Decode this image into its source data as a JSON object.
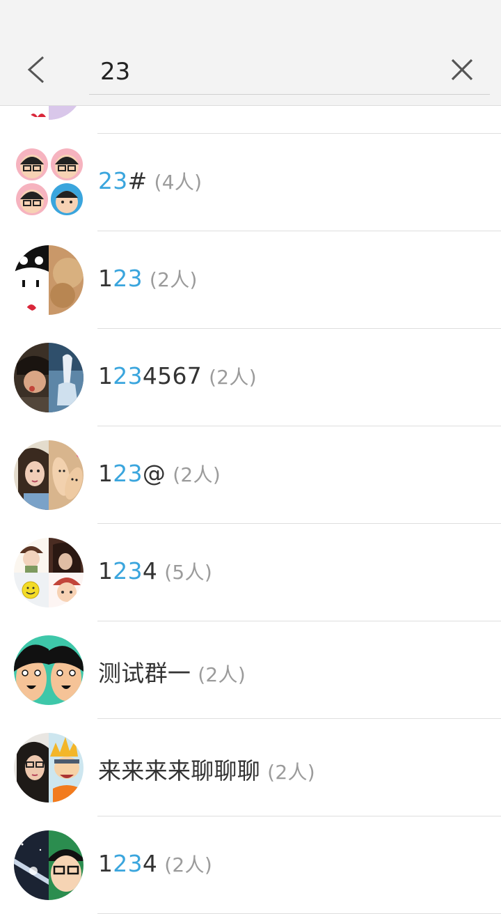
{
  "search": {
    "value": "23"
  },
  "groups": [
    {
      "pre": "",
      "hl": "",
      "post": "",
      "count": ""
    },
    {
      "pre": "",
      "hl": "23",
      "post": "#",
      "count": "(4人)"
    },
    {
      "pre": "1",
      "hl": "23",
      "post": "",
      "count": "(2人)"
    },
    {
      "pre": "1",
      "hl": "23",
      "post": "4567",
      "count": "(2人)"
    },
    {
      "pre": "1",
      "hl": "23",
      "post": "@",
      "count": "(2人)"
    },
    {
      "pre": "1",
      "hl": "23",
      "post": "4",
      "count": "(5人)"
    },
    {
      "pre": "测试群一",
      "hl": "",
      "post": "",
      "count": "(2人)"
    },
    {
      "pre": "来来来来聊聊聊",
      "hl": "",
      "post": "",
      "count": "(2人)"
    },
    {
      "pre": "1",
      "hl": "23",
      "post": "4",
      "count": "(2人)"
    }
  ],
  "colors": {
    "highlight": "#3aa5dd",
    "text": "#333333",
    "count": "#9b9b9b"
  },
  "icons": {
    "back": "back-arrow-icon",
    "clear": "clear-x-icon"
  }
}
